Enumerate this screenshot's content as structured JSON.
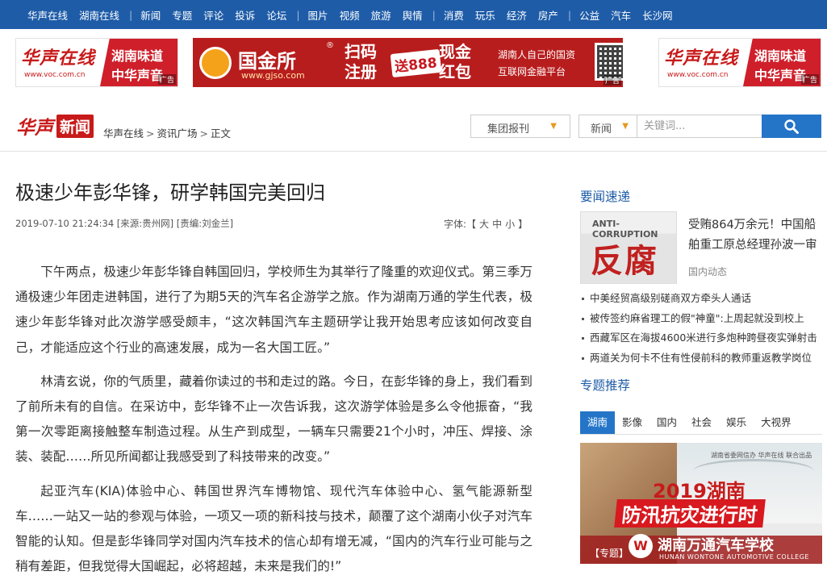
{
  "topnav": {
    "group1": [
      "华声在线",
      "湖南在线"
    ],
    "group2": [
      "新闻",
      "专题",
      "评论",
      "投诉",
      "论坛"
    ],
    "group3": [
      "图片",
      "视频",
      "旅游",
      "舆情"
    ],
    "group4": [
      "消费",
      "玩乐",
      "经济",
      "房产"
    ],
    "group5": [
      "公益",
      "汽车",
      "长沙网"
    ],
    "separator": "|"
  },
  "ads": {
    "voc": {
      "logo": "华声在线",
      "url": "www.voc.com.cn",
      "line1": "湖南味道",
      "line2": "中华声音",
      "tag": "广告"
    },
    "gjs": {
      "brand": "国金所",
      "url": "www.gjso.com",
      "reg": "®",
      "slogan_a": "扫码注册",
      "promo": "送888",
      "slogan_b": "现金红包",
      "desc1": "湖南人自己的国资",
      "desc2": "互联网金融平台",
      "tag": "广告"
    }
  },
  "brand": {
    "site": "华声",
    "section": "新闻"
  },
  "breadcrumb": {
    "item1": "华声在线",
    "item2": "资讯广场",
    "item3": "正文",
    "sep": ">"
  },
  "search": {
    "group_select": "集团报刊",
    "scope": "新闻",
    "placeholder": "关键词..."
  },
  "article": {
    "title": "极速少年彭华锋，研学韩国完美回归",
    "meta": "2019-07-10 21:24:34 [来源:贵州网] [责编:刘金兰]",
    "font_label": "字体:【",
    "font_large": "大",
    "font_mid": "中",
    "font_small": "小",
    "font_end": "】",
    "paragraphs": [
      "下午两点，极速少年彭华锋自韩国回归，学校师生为其举行了隆重的欢迎仪式。第三季万通极速少年团走进韩国，进行了为期5天的汽车名企游学之旅。作为湖南万通的学生代表，极速少年彭华锋对此次游学感受颇丰，“这次韩国汽车主题研学让我开始思考应该如何改变自己，才能适应这个行业的高速发展，成为一名大国工匠。”",
      "林清玄说，你的气质里，藏着你读过的书和走过的路。今日，在彭华锋的身上，我们看到了前所未有的自信。在采访中，彭华锋不止一次告诉我，这次游学体验是多么令他振奋，“我第一次零距离接触整车制造过程。从生产到成型，一辆车只需要21个小时，冲压、焊接、涂装、装配……所见所闻都让我感受到了科技带来的改变。”",
      "起亚汽车(KIA)体验中心、韩国世界汽车博物馆、现代汽车体验中心、氢气能源新型车……一站又一站的参观与体验，一项又一项的新科技与技术，颠覆了这个湖南小伙子对汽车智能的认知。但是彭华锋同学对国内汽车技术的信心却有增无减，“国内的汽车行业可能与之稍有差距，但我觉得大国崛起，必将超越，未来是我们的!”"
    ]
  },
  "sidebar": {
    "news_title": "要闻速递",
    "feature": {
      "thumb_en": "ANTI-CORRUPTION",
      "thumb_cn": "反腐",
      "headline": "受贿864万余元！中国船舶重工原总经理孙波一审",
      "category": "国内动态"
    },
    "news": [
      "中美经贸高级别磋商双方牵头人通话",
      "被传签约麻省理工的假\"神童\":上周起就没到校上",
      "西藏军区在海拔4600米进行多炮种跨昼夜实弹射击",
      "两道关为何卡不住有性侵前科的教师重返教学岗位"
    ],
    "topics_title": "专题推荐",
    "tabs": [
      "湖南",
      "影像",
      "国内",
      "社会",
      "娱乐",
      "大视界"
    ],
    "promo": {
      "small": "湖南省委网信办 华声在线 联合出品",
      "big1": "2019湖南",
      "big2": "防汛抗灾进行时",
      "tag": "【专题】",
      "logo": "W",
      "school": "湖南万通汽车学校",
      "school_en": "HUNAN WONTONE AUTOMOTIVE COLLEGE"
    }
  },
  "colors": {
    "nav_blue": "#1e5ca8",
    "accent_blue": "#2475c8",
    "brand_red": "#c81a1a"
  }
}
